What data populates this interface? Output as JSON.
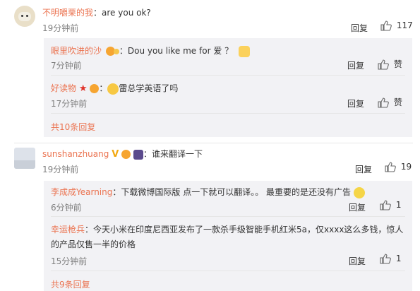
{
  "comments": [
    {
      "user": "不明嚼栗的我",
      "text": "are you ok?",
      "time": "19分钟前",
      "reply_label": "回复",
      "likes": "117",
      "replies": [
        {
          "user": "眼里吹进的沙",
          "text": "Dou you like me for 爱 ？",
          "time": "7分钟前",
          "reply_label": "回复",
          "likes": "赞"
        },
        {
          "user": "好读物",
          "text": "雷总学英语了吗",
          "time": "17分钟前",
          "reply_label": "回复",
          "likes": "赞"
        }
      ],
      "more": "共10条回复"
    },
    {
      "user": "sunshanzhuang",
      "text": "谁来翻译一下",
      "time": "19分钟前",
      "reply_label": "回复",
      "likes": "19",
      "replies": [
        {
          "user": "李成成Yearning",
          "text": "下载微博国际版 点一下就可以翻译。。 最重要的是还没有广告",
          "time": "6分钟前",
          "reply_label": "回复",
          "likes": "1"
        },
        {
          "user": "幸运枪兵",
          "text": "今天小米在印度尼西亚发布了一款杀手级智能手机红米5a，仅xxxx这么多钱，惊人",
          "text2": "的产品仅售一半的价格",
          "time": "15分钟前",
          "reply_label": "回复",
          "likes": "1"
        }
      ],
      "more": "共9条回复"
    }
  ],
  "colors": {
    "username": "#eb7350",
    "reply_bg": "#f2f2f5",
    "text": "#333333",
    "muted": "#808080"
  }
}
